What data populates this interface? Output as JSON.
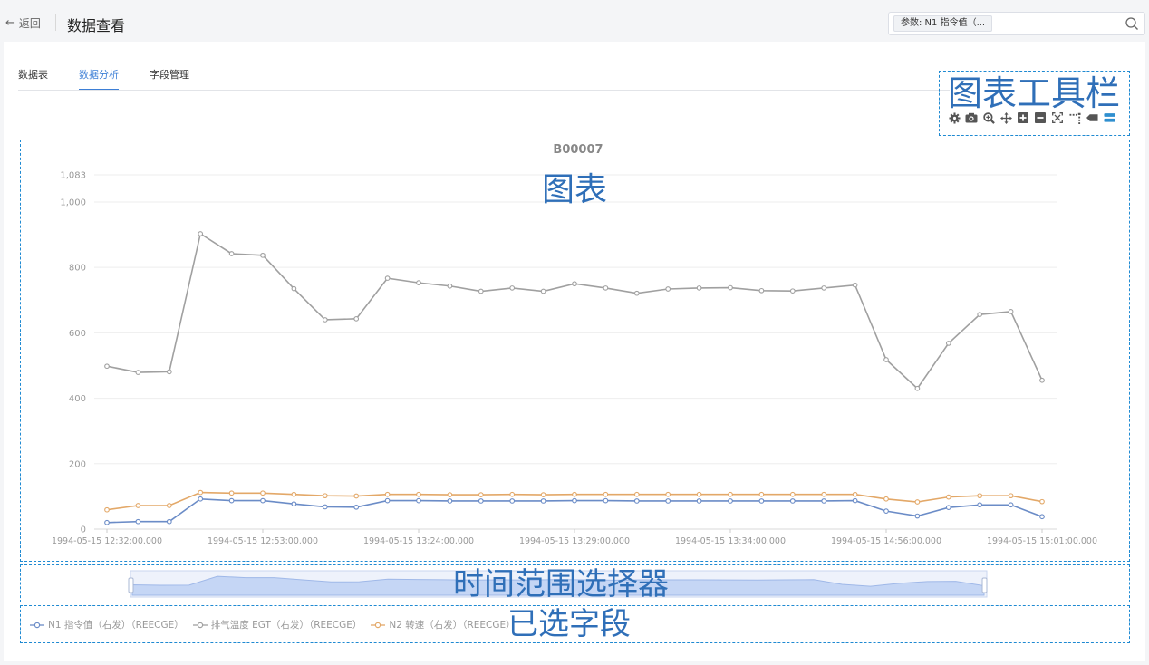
{
  "header": {
    "back_label": "返回",
    "title": "数据查看",
    "search_tag": "参数: N1 指令值（..."
  },
  "tabs": [
    {
      "label": "数据表",
      "active": false
    },
    {
      "label": "数据分析",
      "active": true
    },
    {
      "label": "字段管理",
      "active": false
    }
  ],
  "toolbar": {
    "icons": [
      "gear-icon",
      "camera-icon",
      "zoom-icon",
      "move-icon",
      "plus-square-icon",
      "minus-square-icon",
      "fit-icon",
      "spike-lines-icon",
      "compare-icon",
      "toggle-icon"
    ]
  },
  "annotations": {
    "toolbar": "图表工具栏",
    "chart": "图表",
    "range_selector": "时间范围选择器",
    "selected_fields": "已选字段"
  },
  "legend": [
    {
      "label": "N1 指令值（右发）（REECGE）",
      "color": "#6b8cc7"
    },
    {
      "label": "排气温度 EGT（右发）（REECGE）",
      "color": "#a0a0a0"
    },
    {
      "label": "N2 转速（右发）（REECGE）",
      "color": "#e3a868"
    }
  ],
  "chart_data": {
    "type": "line",
    "title": "B00007",
    "ylim": [
      0,
      1083
    ],
    "yticks": [
      0,
      200,
      400,
      600,
      800,
      1000,
      1083
    ],
    "x_tick_labels": [
      "1994-05-15 12:32:00.000",
      "1994-05-15 12:53:00.000",
      "1994-05-15 13:24:00.000",
      "1994-05-15 13:29:00.000",
      "1994-05-15 13:34:00.000",
      "1994-05-15 14:56:00.000",
      "1994-05-15 15:01:00.000"
    ],
    "x_tick_at_point": [
      0,
      5,
      10,
      15,
      20,
      25,
      30
    ],
    "colors": [
      "#6b8cc7",
      "#a0a0a0",
      "#e3a868"
    ],
    "series": [
      {
        "name": "N1 指令值（右发）（REECGE）",
        "values": [
          20,
          23,
          23,
          92,
          87,
          87,
          77,
          68,
          67,
          87,
          87,
          86,
          86,
          86,
          86,
          87,
          87,
          86,
          86,
          86,
          86,
          86,
          86,
          86,
          87,
          55,
          40,
          66,
          74,
          74,
          38
        ]
      },
      {
        "name": "排气温度 EGT（右发）（REECGE）",
        "values": [
          498,
          479,
          481,
          903,
          842,
          837,
          735,
          640,
          643,
          767,
          753,
          743,
          727,
          737,
          727,
          750,
          737,
          721,
          734,
          737,
          738,
          729,
          728,
          737,
          746,
          518,
          430,
          568,
          656,
          665,
          455
        ]
      },
      {
        "name": "N2 转速（右发）（REECGE）",
        "values": [
          59,
          72,
          72,
          112,
          110,
          110,
          106,
          102,
          101,
          106,
          106,
          105,
          105,
          106,
          105,
          106,
          106,
          106,
          106,
          106,
          106,
          106,
          106,
          106,
          106,
          92,
          83,
          98,
          102,
          102,
          84
        ]
      }
    ]
  }
}
